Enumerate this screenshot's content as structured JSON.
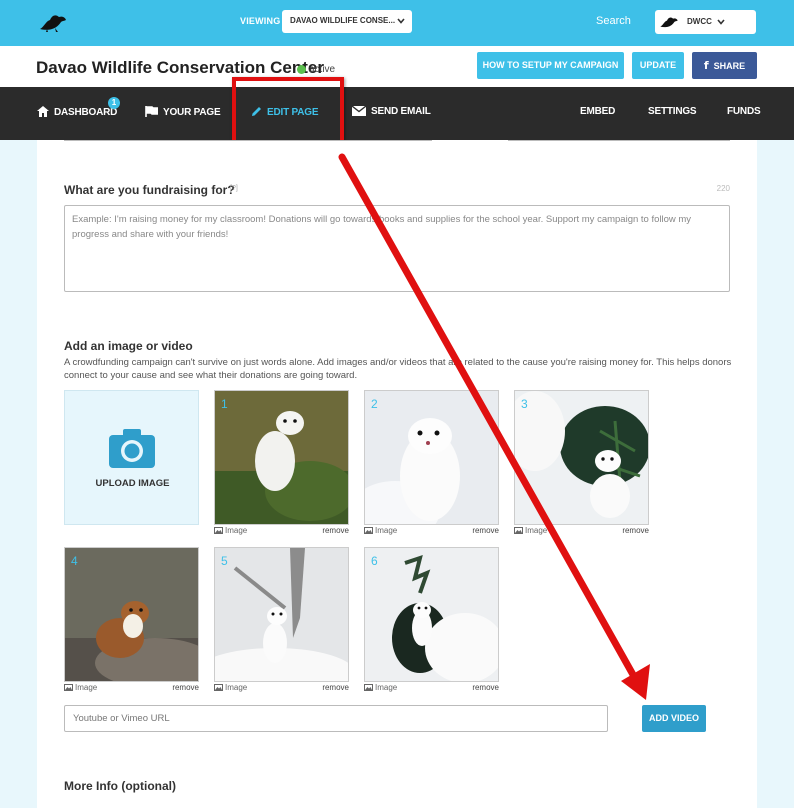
{
  "header": {
    "viewing_label": "VIEWING",
    "viewing_value": "DAVAO WILDLIFE CONSE...",
    "search_label": "Search",
    "account_name": "DWCC"
  },
  "title_row": {
    "org_name": "Davao Wildlife Conservation Center",
    "status": "active",
    "howto_label": "HOW TO SETUP MY CAMPAIGN",
    "update_label": "UPDATE",
    "share_label": "SHARE",
    "share_icon": "f"
  },
  "nav": {
    "dashboard": "DASHBOARD",
    "dashboard_badge": "1",
    "your_page": "YOUR PAGE",
    "edit_page": "EDIT PAGE",
    "send_email": "SEND EMAIL",
    "embed": "EMBED",
    "settings": "SETTINGS",
    "funds": "FUNDS"
  },
  "fundraising": {
    "title": "What are you fundraising for?",
    "help": "[?]",
    "char_count": "220",
    "placeholder": "Example: I'm raising money for my classroom! Donations will go towards books and supplies for the school year. Support my campaign to follow my progress and share with your friends!"
  },
  "media": {
    "title": "Add an image or video",
    "description": "A crowdfunding campaign can't survive on just words alone. Add images and/or videos that are related to the cause you're raising money for. This helps donors connect to your cause and see what their donations are going toward.",
    "upload_label": "UPLOAD IMAGE",
    "items": [
      {
        "num": "1",
        "type": "Image",
        "remove": "remove"
      },
      {
        "num": "2",
        "type": "Image",
        "remove": "remove"
      },
      {
        "num": "3",
        "type": "Image",
        "remove": "remove"
      },
      {
        "num": "4",
        "type": "Image",
        "remove": "remove"
      },
      {
        "num": "5",
        "type": "Image",
        "remove": "remove"
      },
      {
        "num": "6",
        "type": "Image",
        "remove": "remove"
      }
    ],
    "video_placeholder": "Youtube or Vimeo URL",
    "add_video_label": "ADD VIDEO"
  },
  "more_info": {
    "title": "More Info (optional)"
  },
  "colors": {
    "brand": "#3ec0e8",
    "nav_bg": "#2b2b2b",
    "facebook": "#3b5998",
    "annotation": "#e01010"
  }
}
